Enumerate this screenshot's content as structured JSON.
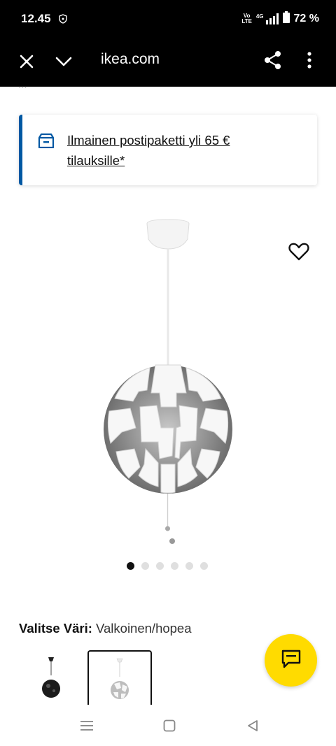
{
  "status_bar": {
    "time": "12.45",
    "network": "4G",
    "volte_line1": "Vo",
    "volte_line2": "LTE",
    "battery": "72 %"
  },
  "browser": {
    "url": "ikea.com"
  },
  "breadcrumb": {
    "items": [
      "..."
    ]
  },
  "promo": {
    "text": "Ilmainen postipaketti yli 65 € tilauksille*"
  },
  "gallery": {
    "image_count": 6,
    "active_index": 0
  },
  "color_selector": {
    "label": "Valitse Väri:",
    "value": "Valkoinen/hopea",
    "selected_index": 1
  },
  "colors": {
    "accent": "#0058a3",
    "chat_button": "#ffdb00"
  }
}
